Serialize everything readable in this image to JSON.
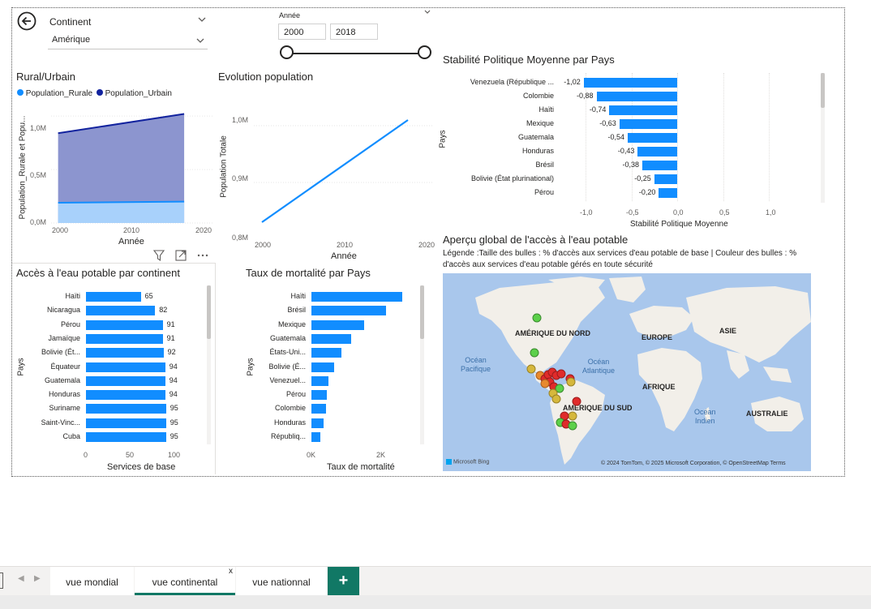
{
  "filters": {
    "continent_label": "Continent",
    "continent_value": "Amérique",
    "year_label": "Année",
    "year_start": "2000",
    "year_end": "2018"
  },
  "rural_urban": {
    "title": "Rural/Urbain",
    "legend": [
      "Population_Rurale",
      "Population_Urbain"
    ],
    "colors": {
      "rurale": "#118DFF",
      "urbain": "#12239E",
      "area": "#8C95CF",
      "area_rural": "#A8D1FB"
    },
    "ylabel": "Population_Rurale et Popu...",
    "xlabel": "Année",
    "yticks": [
      "1,0M",
      "0,5M",
      "0,0M"
    ],
    "xticks": [
      "2000",
      "2010",
      "2020"
    ]
  },
  "evolution": {
    "title": "Evolution population",
    "ylabel": "Population Totale",
    "xlabel": "Année",
    "yticks": [
      "1,0M",
      "0,9M",
      "0,8M"
    ],
    "xticks": [
      "2000",
      "2010",
      "2020"
    ]
  },
  "stabilite": {
    "title": "Stabilité Politique Moyenne par Pays",
    "ylabel": "Pays",
    "xlabel": "Stabilité Politique Moyenne",
    "xticks": [
      "-1,0",
      "-0,5",
      "0,0",
      "0,5",
      "1,0"
    ]
  },
  "eau_continent": {
    "title": "Accès à l'eau potable par continent",
    "ylabel": "Pays",
    "xlabel": "Services de base",
    "xticks": [
      "0",
      "50",
      "100"
    ]
  },
  "mortalite": {
    "title": "Taux de mortalité par Pays",
    "ylabel": "Pays",
    "xlabel": "Taux de mortalité",
    "xticks": [
      "0K",
      "2K"
    ]
  },
  "map": {
    "title": "Aperçu global de l'accès à l'eau potable",
    "legend_line1": "Légende :Taille des bulles : % d'accès aux services d'eau potable de base | Couleur des bulles : %",
    "legend_line2": "d'accès aux services d'eau potable gérés en toute sécurité",
    "labels": {
      "amerique_nord": "AMÉRIQUE DU NORD",
      "europe": "EUROPE",
      "asie": "ASIE",
      "afrique": "AFRIQUE",
      "amerique_sud": "AMÉRIQUE DU SUD",
      "australie": "AUSTRALIE",
      "ocean_pacifique_1": "Océan",
      "ocean_pacifique_2": "Pacifique",
      "ocean_atlantique_1": "Océan",
      "ocean_atlantique_2": "Atlantique",
      "ocean_indien_1": "Océan",
      "ocean_indien_2": "Indien"
    },
    "bing": "Microsoft Bing",
    "copyright": "© 2024 TomTom, © 2025 Microsoft Corporation, © OpenStreetMap  Terms",
    "bubble_colors": {
      "green": "#5cd04a",
      "yellow": "#d6b83c",
      "orange": "#e8892d",
      "red": "#e02b2b"
    }
  },
  "tabs": {
    "tab1": "vue mondial",
    "tab2": "vue continental",
    "tab2_close": "x",
    "tab3": "vue nationnal",
    "add": "+"
  },
  "chart_data": [
    {
      "type": "area",
      "title": "Rural/Urbain",
      "x": [
        2000,
        2018
      ],
      "series": [
        {
          "name": "Population_Rurale",
          "values": [
            0.19,
            0.2
          ]
        },
        {
          "name": "Population_Urbain",
          "values": [
            0.84,
            1.02
          ]
        }
      ],
      "ylabel": "Population_Rurale et Popu...",
      "xlabel": "Année",
      "ylim": [
        0,
        1.1
      ],
      "xlim": [
        1999,
        2021
      ]
    },
    {
      "type": "line",
      "title": "Evolution population",
      "x": [
        2000,
        2018
      ],
      "series": [
        {
          "values": [
            0.83,
            1.01
          ]
        }
      ],
      "ylabel": "Population Totale",
      "xlabel": "Année",
      "ylim": [
        0.8,
        1.05
      ],
      "xlim": [
        1999,
        2021
      ]
    },
    {
      "type": "bar",
      "title": "Stabilité Politique Moyenne par Pays",
      "categories": [
        "Venezuela (République ...",
        "Colombie",
        "Haïti",
        "Mexique",
        "Guatemala",
        "Honduras",
        "Brésil",
        "Bolivie (État plurinational)",
        "Pérou"
      ],
      "values": [
        -1.02,
        -0.88,
        -0.74,
        -0.63,
        -0.54,
        -0.43,
        -0.38,
        -0.25,
        -0.2
      ],
      "value_labels": [
        "-1,02",
        "-0,88",
        "-0,74",
        "-0,63",
        "-0,54",
        "-0,43",
        "-0,38",
        "-0,25",
        "-0,20"
      ],
      "xlim": [
        -1.2,
        1.2
      ]
    },
    {
      "type": "bar",
      "title": "Accès à l'eau potable par continent",
      "categories": [
        "Haïti",
        "Nicaragua",
        "Pérou",
        "Jamaïque",
        "Bolivie (Ét...",
        "Équateur",
        "Guatemala",
        "Honduras",
        "Suriname",
        "Saint-Vinc...",
        "Cuba"
      ],
      "values": [
        65,
        82,
        91,
        91,
        92,
        94,
        94,
        94,
        95,
        95,
        95
      ],
      "xlim": [
        0,
        110
      ]
    },
    {
      "type": "bar",
      "title": "Taux de mortalité par Pays",
      "categories": [
        "Haïti",
        "Brésil",
        "Mexique",
        "Guatemala",
        "États-Uni...",
        "Bolivie (É...",
        "Venezuel...",
        "Pérou",
        "Colombie",
        "Honduras",
        "Républiq..."
      ],
      "values": [
        2.6,
        2.15,
        1.5,
        1.15,
        0.85,
        0.65,
        0.48,
        0.45,
        0.42,
        0.35,
        0.25
      ],
      "xlim": [
        0,
        2.9
      ]
    }
  ]
}
